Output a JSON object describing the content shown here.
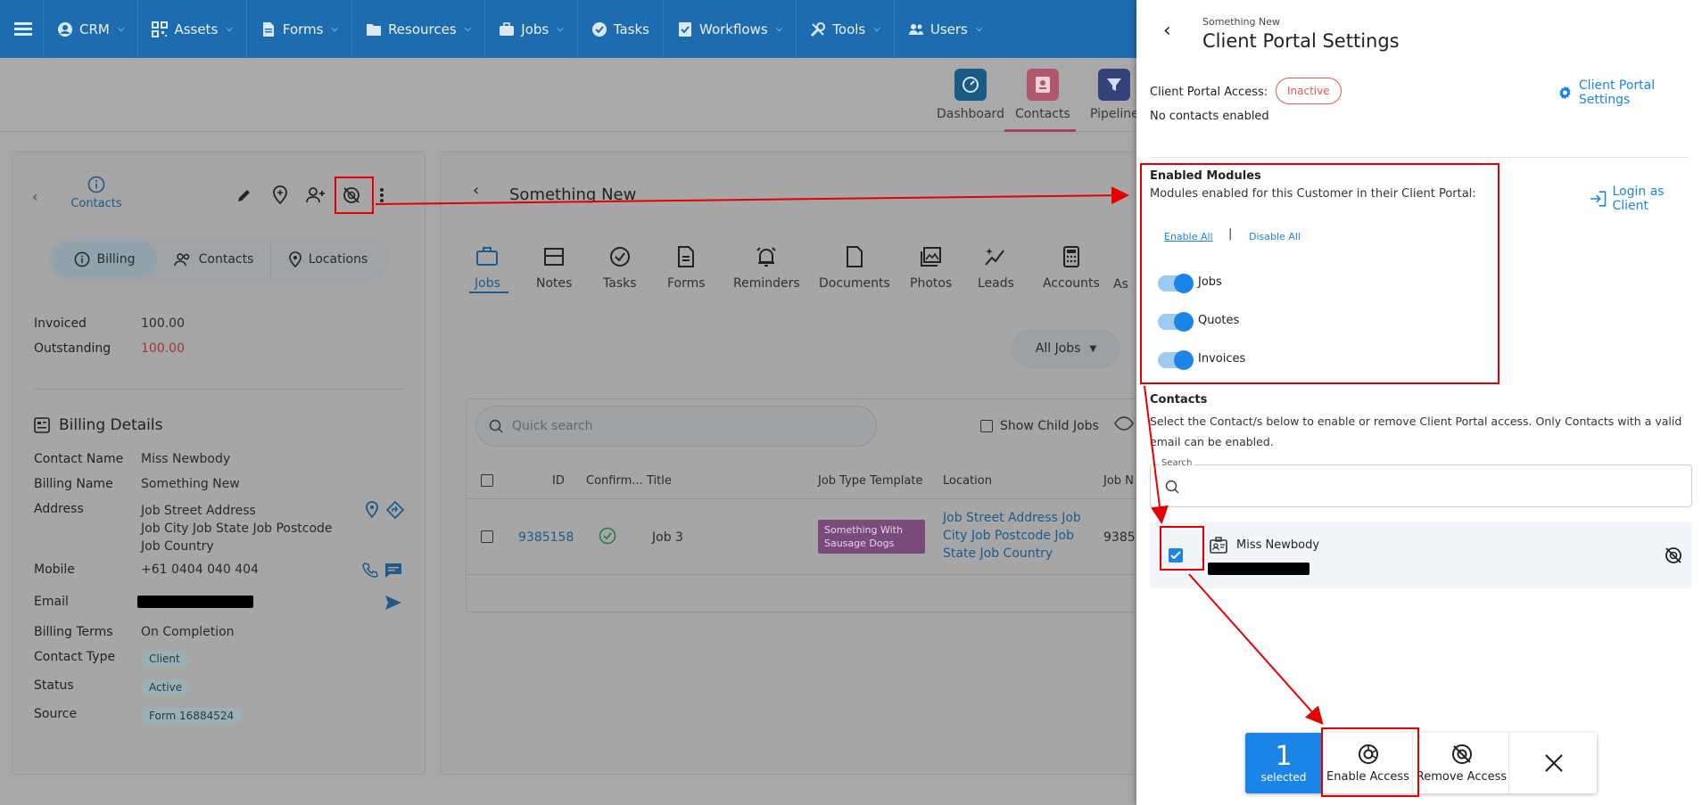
{
  "nav": {
    "items": [
      {
        "label": "CRM",
        "icon": "user-circle-icon"
      },
      {
        "label": "Assets",
        "icon": "qr-code-icon"
      },
      {
        "label": "Forms",
        "icon": "document-icon"
      },
      {
        "label": "Resources",
        "icon": "folder-icon"
      },
      {
        "label": "Jobs",
        "icon": "briefcase-icon"
      },
      {
        "label": "Tasks",
        "icon": "check-circle-icon"
      },
      {
        "label": "Workflows",
        "icon": "checklist-icon"
      },
      {
        "label": "Tools",
        "icon": "tools-icon"
      },
      {
        "label": "Users",
        "icon": "users-icon"
      }
    ]
  },
  "apps": {
    "dashboard": "Dashboard",
    "contacts": "Contacts",
    "pipeline": "Pipeline"
  },
  "left": {
    "back_label": "Contacts",
    "subtabs": {
      "billing": "Billing",
      "contacts": "Contacts",
      "locations": "Locations"
    },
    "invoiced_label": "Invoiced",
    "invoiced_value": "100.00",
    "outstanding_label": "Outstanding",
    "outstanding_value": "100.00",
    "billing_details_title": "Billing Details",
    "fields": {
      "contact_name_label": "Contact Name",
      "contact_name_value": "Miss Newbody",
      "billing_name_label": "Billing Name",
      "billing_name_value": "Something New",
      "address_label": "Address",
      "address_line1": "Job Street Address",
      "address_line2": "Job City Job State Job Postcode",
      "address_line3": "Job Country",
      "mobile_label": "Mobile",
      "mobile_value": "+61 0404 040 404",
      "email_label": "Email",
      "billing_terms_label": "Billing Terms",
      "billing_terms_value": "On Completion",
      "contact_type_label": "Contact Type",
      "contact_type_value": "Client",
      "status_label": "Status",
      "status_value": "Active",
      "source_label": "Source",
      "source_value": "Form 16884524"
    }
  },
  "middle": {
    "title": "Something New",
    "tabs": [
      "Jobs",
      "Notes",
      "Tasks",
      "Forms",
      "Reminders",
      "Documents",
      "Photos",
      "Leads",
      "Accounts",
      "As"
    ],
    "all_jobs": "All Jobs",
    "search_placeholder": "Quick search",
    "show_child_jobs": "Show Child Jobs",
    "columns": [
      "ID",
      "Confirm...",
      "Title",
      "Job Type Template",
      "Location",
      "Job N"
    ],
    "row": {
      "id": "9385158",
      "title": "Job 3",
      "template_line1": "Something With",
      "template_line2": "Sausage Dogs",
      "location_line1": "Job Street Address Job",
      "location_line2": "City Job Postcode Job",
      "location_line3": "State Job Country",
      "job_n": "9385"
    }
  },
  "panel": {
    "subtitle": "Something New",
    "title": "Client Portal Settings",
    "access_label": "Client Portal Access:",
    "access_status": "Inactive",
    "no_contacts": "No contacts enabled",
    "settings_link": "Client Portal Settings",
    "modules_title": "Enabled Modules",
    "modules_desc": "Modules enabled for this Customer in their Client Portal:",
    "login_as_client": "Login as Client",
    "enable_all": "Enable All",
    "separator": "|",
    "disable_all": "Disable All",
    "modules": [
      {
        "label": "Jobs",
        "enabled": true
      },
      {
        "label": "Quotes",
        "enabled": true
      },
      {
        "label": "Invoices",
        "enabled": true
      }
    ],
    "contacts_title": "Contacts",
    "contacts_desc_line1": "Select the Contact/s below to enable or remove Client Portal access. Only Contacts with a valid",
    "contacts_desc_line2": "email can be enabled.",
    "search_label": "Search",
    "contact": {
      "name": "Miss Newbody",
      "checked": true
    },
    "bottom": {
      "count": "1",
      "selected": "selected",
      "enable_access": "Enable Access",
      "remove_access": "Remove Access"
    }
  },
  "colors": {
    "nav_blue": "#1d6cb0",
    "accent_blue": "#1a85e6",
    "inactive_red": "#e05555",
    "annotation_red": "#e30000"
  }
}
